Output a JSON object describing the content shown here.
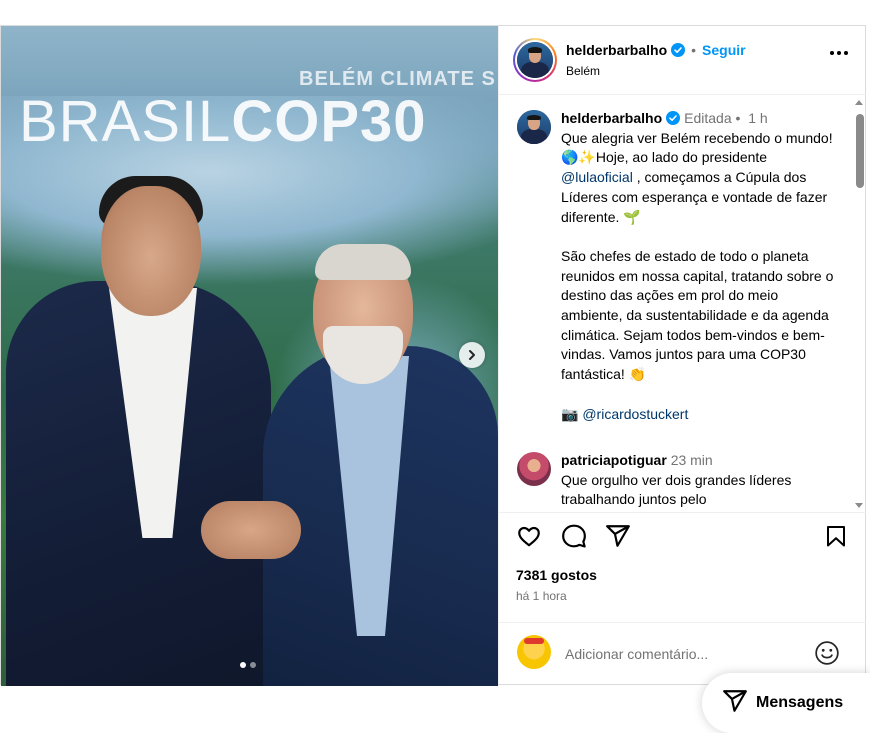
{
  "media": {
    "banner_subtitle": "BELÉM CLIMATE S",
    "banner_title_light": "BRASIL",
    "banner_title_bold": "COP30",
    "carousel_position": 1,
    "carousel_count": 2
  },
  "header": {
    "username": "helderbarbalho",
    "separator": "•",
    "follow_label": "Seguir",
    "location": "Belém"
  },
  "caption": {
    "username": "helderbarbalho",
    "edited_label": "Editada",
    "separator": "•",
    "time": "1 h",
    "paragraph1_a": "Que alegria ver Belém recebendo o mundo! 🌎✨Hoje, ao lado do presidente ",
    "mention": "@lulaoficial",
    "paragraph1_b": " , começamos a Cúpula dos Líderes com esperança e vontade de fazer diferente. 🌱",
    "paragraph2": "São chefes de estado de todo o planeta reunidos em nossa capital, tratando sobre o destino das ações em prol do meio ambiente, da sustentabilidade e da agenda climática. Sejam todos bem-vindos e bem-vindas. Vamos juntos para uma COP30 fantástica! 👏",
    "photo_credit_icon": "📷",
    "photo_credit": "@ricardostuckert"
  },
  "comment": {
    "username": "patriciapotiguar",
    "time": "23 min",
    "text": "Que orgulho ver dois grandes líderes trabalhando juntos pelo"
  },
  "actions": {
    "icons": [
      "heart-icon",
      "comment-icon",
      "share-icon",
      "bookmark-icon"
    ]
  },
  "likes_label": "7381 gostos",
  "time_ago": "há 1 hora",
  "add_comment": {
    "placeholder": "Adicionar comentário..."
  },
  "messages": {
    "label": "Mensagens"
  },
  "colors": {
    "accent": "#0095f6",
    "mention": "#00376b",
    "muted": "#737373"
  }
}
